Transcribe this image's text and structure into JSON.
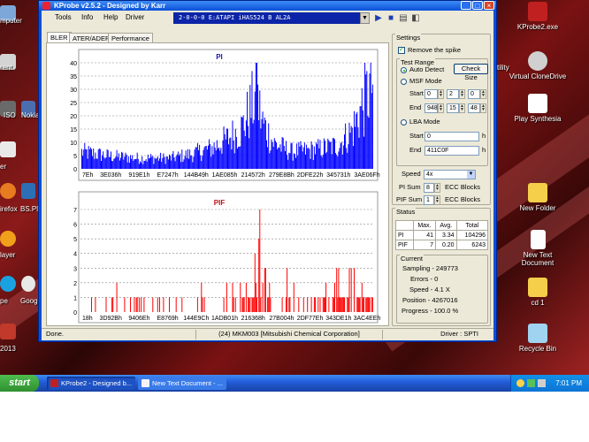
{
  "window": {
    "title": "KProbe v2.5.2 - Designed by Karr",
    "controls": {
      "minimize": "_",
      "maximize": "□",
      "close": "×"
    }
  },
  "menu": [
    "Tools",
    "Info",
    "Help",
    "Driver"
  ],
  "toolbar": {
    "drive": "2-0-0-0 E:ATAPI  iHAS524  B     AL2A",
    "dropdown": "▼",
    "play": "▶",
    "stop": "■",
    "report": "▤",
    "save": "◧"
  },
  "tabs": [
    "BLER",
    "ATER/ADER",
    "Performance"
  ],
  "graphs": {
    "pi": {
      "title": "PI",
      "y_ticks": [
        "40",
        "35",
        "30",
        "25",
        "20",
        "15",
        "10",
        "5",
        "0"
      ],
      "x_ticks": [
        "7Eh",
        "3E036h",
        "919E1h",
        "E7247h",
        "144B49h",
        "1AE085h",
        "214572h",
        "279E8Bh",
        "2DFE22h",
        "345731h",
        "3AE06Fh"
      ]
    },
    "pif": {
      "title": "PIF",
      "y_ticks": [
        "7",
        "6",
        "5",
        "4",
        "3",
        "2",
        "1",
        "0"
      ],
      "x_ticks": [
        "18h",
        "3D92Bh",
        "9406Eh",
        "E8769h",
        "144E9Ch",
        "1ADB01h",
        "216368h",
        "27B004h",
        "2DF77Eh",
        "343DE1h",
        "3AC4EEh"
      ]
    }
  },
  "chart_data": [
    {
      "type": "bar",
      "title": "PI",
      "ylim": [
        0,
        40
      ],
      "x_ticks": [
        "7Eh",
        "3E036h",
        "919E1h",
        "E7247h",
        "144B49h",
        "1AE085h",
        "214572h",
        "279E8Bh",
        "2DFE22h",
        "345731h",
        "3AE06Fh"
      ],
      "profile": [
        [
          0,
          8
        ],
        [
          0.1,
          6
        ],
        [
          0.2,
          5
        ],
        [
          0.3,
          5
        ],
        [
          0.38,
          7
        ],
        [
          0.45,
          10
        ],
        [
          0.5,
          14
        ],
        [
          0.55,
          19
        ],
        [
          0.58,
          28
        ],
        [
          0.6,
          35
        ],
        [
          0.62,
          22
        ],
        [
          0.66,
          12
        ],
        [
          0.72,
          8
        ],
        [
          0.8,
          9
        ],
        [
          0.88,
          11
        ],
        [
          0.93,
          18
        ],
        [
          0.96,
          28
        ],
        [
          1.0,
          41
        ]
      ],
      "max": 41
    },
    {
      "type": "bar",
      "title": "PIF",
      "ylim": [
        0,
        7
      ],
      "x_ticks": [
        "18h",
        "3D92Bh",
        "9406Eh",
        "E8769h",
        "144E9Ch",
        "1ADB01h",
        "216368h",
        "27B004h",
        "2DF77Eh",
        "343DE1h",
        "3AC4EEh"
      ],
      "max": 7
    }
  ],
  "settings": {
    "title": "Settings",
    "remove_spike": "Remove the spike",
    "test_range": "Test Range",
    "auto_detect": "Auto Detect",
    "check_size": "Check Size",
    "msf_mode": "MSF Mode",
    "start_label": "Start",
    "end_label": "End",
    "msf_start": [
      "0",
      "2",
      "0"
    ],
    "msf_end": [
      "948",
      "15",
      "48"
    ],
    "lba_mode": "LBA Mode",
    "lba_start": "0",
    "lba_end": "411C0F",
    "h": "h",
    "speed_label": "Speed",
    "speed_value": "4x",
    "pi_sum_label": "PI Sum",
    "pi_sum_value": "8",
    "pif_sum_label": "PIF Sum",
    "pif_sum_value": "1",
    "ecc_blocks": "ECC Blocks"
  },
  "status": {
    "title": "Status",
    "headers": [
      "",
      "Max.",
      "Avg.",
      "Total"
    ],
    "rows": [
      [
        "PI",
        "41",
        "3.34",
        "104296"
      ],
      [
        "PIF",
        "7",
        "0.20",
        "6243"
      ]
    ],
    "current_title": "Current",
    "sampling": "Sampling -  249773",
    "errors": "Errors -  0",
    "speed": "Speed -  4.1  X",
    "position": "Position -  4267016",
    "progress": "Progress -  100.0 %"
  },
  "statusbar": {
    "left": "Done.",
    "middle": "(24) MKM003 [Mitsubishi Chemical Corporation]",
    "right": "Driver : SPTI"
  },
  "desktop": {
    "right_icons": [
      "KProbe2.exe",
      "Virtual CloneDrive",
      "Play Synthesia",
      "New Folder",
      "New Text Document",
      "cd 1",
      "Recycle Bin"
    ],
    "partial_right": "tility",
    "left_fragments": [
      "mputer",
      "rent",
      "ISO",
      "Nokia",
      "er",
      "irefox",
      "BS.Pla",
      "layer",
      "pe",
      "Googl",
      "2013"
    ]
  },
  "taskbar": {
    "start": "start",
    "buttons": [
      "KProbe2 - Designed b...",
      "New Text Document - ..."
    ],
    "clock": "7:01 PM"
  },
  "colors": {
    "pi_bar": "#0000ff",
    "pif_bar": "#ff0000",
    "titlebar": "#0a50d8",
    "face": "#ece9d8"
  }
}
